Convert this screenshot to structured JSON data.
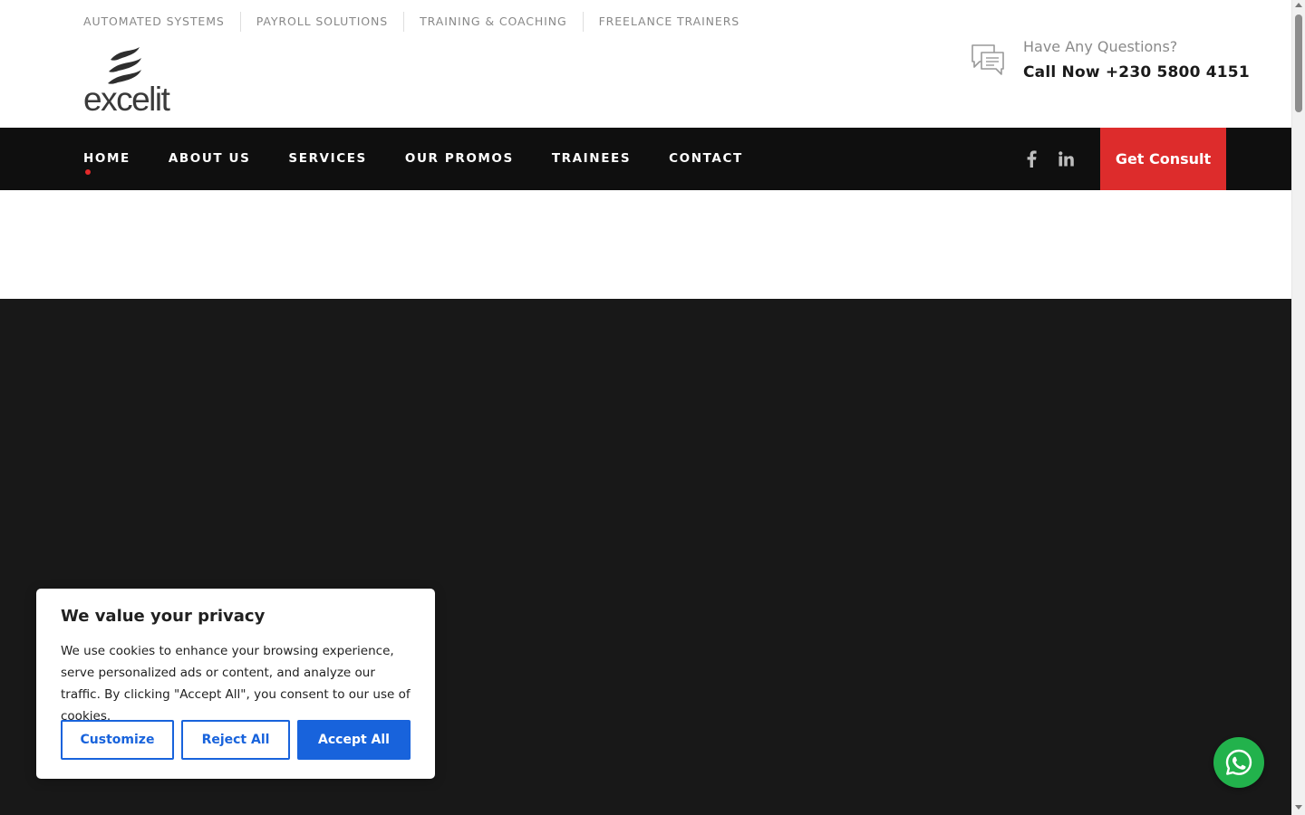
{
  "top_links": [
    "AUTOMATED SYSTEMS",
    "PAYROLL SOLUTIONS",
    "TRAINING & COACHING",
    "FREELANCE TRAINERS"
  ],
  "logo": {
    "text": "excelit"
  },
  "contact": {
    "question": "Have Any Questions?",
    "phone": "Call Now +230 5800 4151",
    "icon": "chat-bubbles-icon"
  },
  "nav": {
    "items": [
      "HOME",
      "ABOUT US",
      "SERVICES",
      "OUR PROMOS",
      "TRAINEES",
      "CONTACT"
    ],
    "active": "HOME",
    "social": [
      "facebook-icon",
      "linkedin-icon"
    ],
    "cta": "Get Consult"
  },
  "cookie": {
    "title": "We value your privacy",
    "text": "We use cookies to enhance your browsing experience, serve personalized ads or content, and analyze our traffic. By clicking \"Accept All\", you consent to our use of cookies.",
    "customize": "Customize",
    "reject": "Reject All",
    "accept": "Accept All"
  },
  "colors": {
    "accent_red": "#dd2c2c",
    "nav_bg": "#0f0f0f",
    "hero_bg": "#181818",
    "cookie_blue": "#1863dc",
    "whatsapp_green": "#22b24c"
  },
  "widgets": {
    "whatsapp": "whatsapp-icon"
  }
}
